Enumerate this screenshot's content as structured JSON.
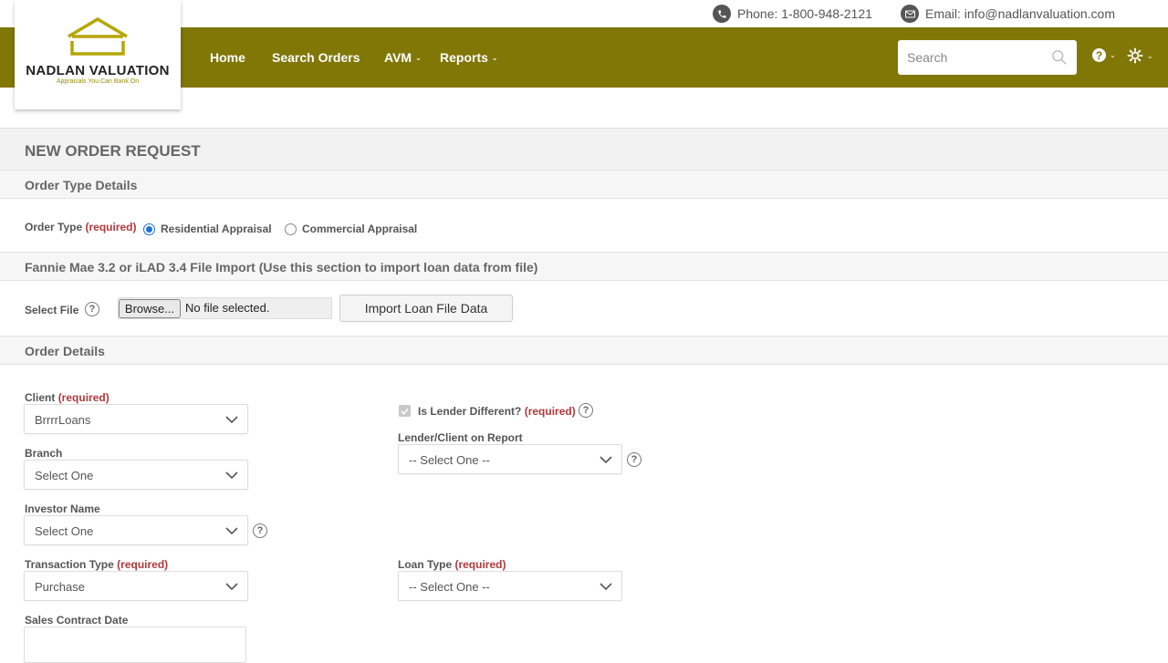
{
  "contact": {
    "phone": "Phone: 1-800-948-2121",
    "email": "Email: info@nadlanvaluation.com"
  },
  "brand": {
    "name": "NADLAN VALUATION",
    "tagline": "Appraisals You Can Bank On",
    "nav_color": "#807707"
  },
  "nav": {
    "home": "Home",
    "search_orders": "Search Orders",
    "avm": "AVM",
    "reports": "Reports"
  },
  "search": {
    "placeholder": "Search"
  },
  "page": {
    "title": "NEW ORDER REQUEST"
  },
  "order_type": {
    "section_title": "Order Type Details",
    "label": "Order Type",
    "required": "(required)",
    "options": [
      "Residential Appraisal",
      "Commercial Appraisal"
    ],
    "selected": "Residential Appraisal"
  },
  "file_import": {
    "section_title": "Fannie Mae 3.2 or iLAD 3.4 File Import (Use this section to import loan data from file)",
    "label": "Select File",
    "browse": "Browse...",
    "status": "No file selected.",
    "import_button": "Import Loan File Data"
  },
  "order_details": {
    "section_title": "Order Details",
    "client": {
      "label": "Client",
      "required": "(required)",
      "value": "BrrrrLoans"
    },
    "branch": {
      "label": "Branch",
      "value": "Select One"
    },
    "investor": {
      "label": "Investor Name",
      "value": "Select One"
    },
    "transaction": {
      "label": "Transaction Type",
      "required": "(required)",
      "value": "Purchase"
    },
    "sales_contract": {
      "label": "Sales Contract Date",
      "value": ""
    },
    "lender_different": {
      "label": "Is Lender Different?",
      "required": "(required)",
      "checked": true
    },
    "lender_client": {
      "label": "Lender/Client on Report",
      "value": "-- Select One --"
    },
    "loan_type": {
      "label": "Loan Type",
      "required": "(required)",
      "value": "-- Select One --"
    }
  },
  "icons": {
    "phone": "phone-icon",
    "email": "envelope-icon",
    "search": "search-icon",
    "help": "question-circle-icon",
    "settings": "gear-icon",
    "dropdown": "chevron-down-icon"
  }
}
